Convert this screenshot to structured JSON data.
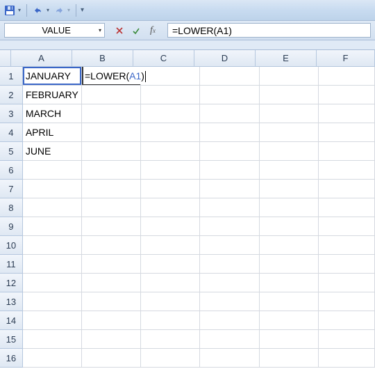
{
  "qat": {
    "save": "save-icon",
    "undo": "undo-icon",
    "redo": "redo-icon"
  },
  "name_box": "VALUE",
  "formula_bar": "=LOWER(A1)",
  "formula_prefix": "=LOWER(",
  "formula_ref": "A1",
  "formula_suffix": ")",
  "columns": [
    "A",
    "B",
    "C",
    "D",
    "E",
    "F"
  ],
  "col_widths": [
    "cw-A",
    "cw-B",
    "cw-C",
    "cw-D",
    "cw-E",
    "cw-F"
  ],
  "rows": [
    1,
    2,
    3,
    4,
    5,
    6,
    7,
    8,
    9,
    10,
    11,
    12,
    13,
    14,
    15,
    16
  ],
  "cells": {
    "A1": "JANUARY",
    "A2": "FEBRUARY",
    "A3": "MARCH",
    "A4": "APRIL",
    "A5": "JUNE"
  },
  "editing_cell": "B1"
}
